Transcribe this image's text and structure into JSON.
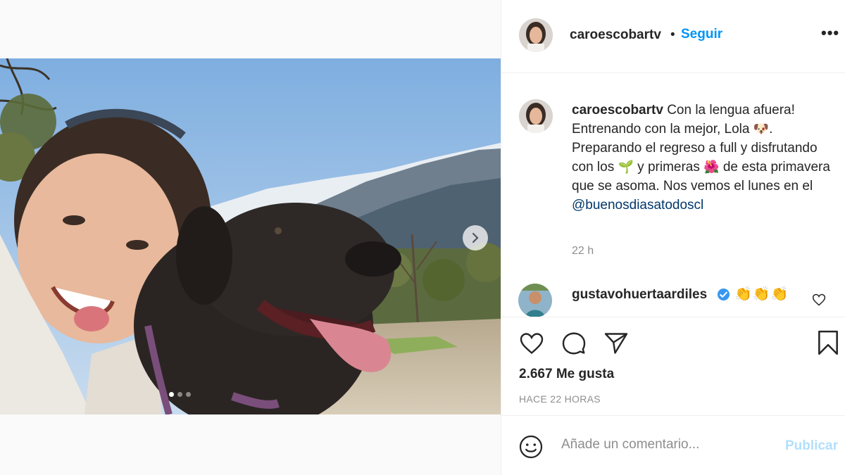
{
  "post": {
    "username": "caroescobartv",
    "separator": "•",
    "follow_label": "Seguir",
    "more_label": "•••"
  },
  "caption": {
    "username": "caroescobartv",
    "text_1": "Con la lengua afuera! Entrenando con la mejor, Lola ",
    "emoji_dog": "🐶",
    "text_2": ". Preparando el regreso a full y disfrutando con los ",
    "emoji_sprout": "🌱",
    "text_3": " y primeras ",
    "emoji_flower": "🌺",
    "text_4": " de esta primavera que se asoma. Nos vemos el lunes en el ",
    "mention": "@buenosdiasatodoscl",
    "time": "22 h"
  },
  "comment": {
    "username": "gustavohuertaardiles",
    "text": "👏👏👏",
    "verified": true
  },
  "actions": {
    "likes": "2.667 Me gusta",
    "posted_ago": "HACE 22 HORAS"
  },
  "comment_box": {
    "placeholder": "Añade un comentario...",
    "publish_label": "Publicar"
  },
  "carousel": {
    "slides": 3,
    "current": 1
  },
  "colors": {
    "accent": "#0095f6",
    "publish_disabled": "#b2dffc",
    "mention": "#00376b",
    "muted": "#8e8e8e"
  }
}
